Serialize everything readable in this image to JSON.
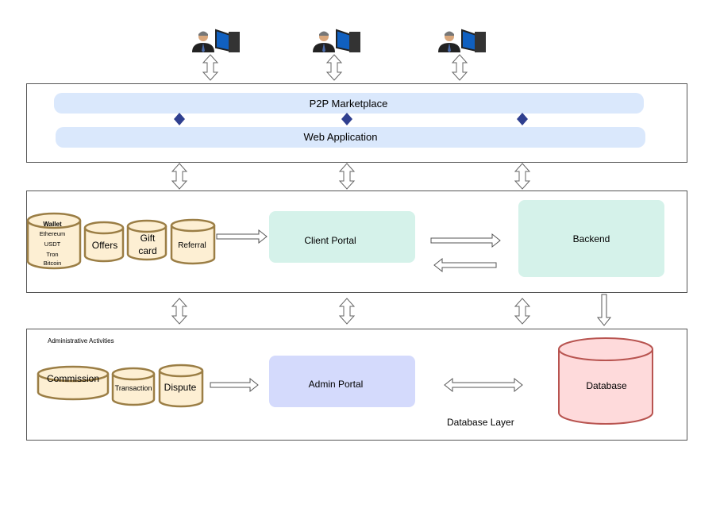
{
  "users": [
    {
      "icon": "user-computer-icon"
    },
    {
      "icon": "user-computer-icon"
    },
    {
      "icon": "user-computer-icon"
    }
  ],
  "frontend": {
    "marketplace": "P2P Marketplace",
    "web_app": "Web Application"
  },
  "services": {
    "wallet": {
      "title": "Wallet",
      "items": [
        "Ethereum",
        "USDT",
        "Tron",
        "Bitcoin"
      ]
    },
    "offers": "Offers",
    "gift_card": [
      "Gift",
      "card"
    ],
    "referral": "Referral",
    "client_portal": "Client Portal",
    "backend": "Backend"
  },
  "admin": {
    "section_label": "Administrative Activities",
    "commission": "Commission",
    "transaction": "Transaction",
    "dispute": "Dispute",
    "admin_portal": "Admin Portal",
    "database": "Database",
    "database_layer": "Database Layer"
  },
  "colors": {
    "bar": "#dae8fc",
    "cylinder_fill": "#fdefd3",
    "cylinder_stroke": "#9b7e45",
    "client_portal": "#d5f2ea",
    "admin_portal": "#d4dafc",
    "database": "#fedadb",
    "database_stroke": "#b85450",
    "small_arrow": "#2f3f8f"
  }
}
